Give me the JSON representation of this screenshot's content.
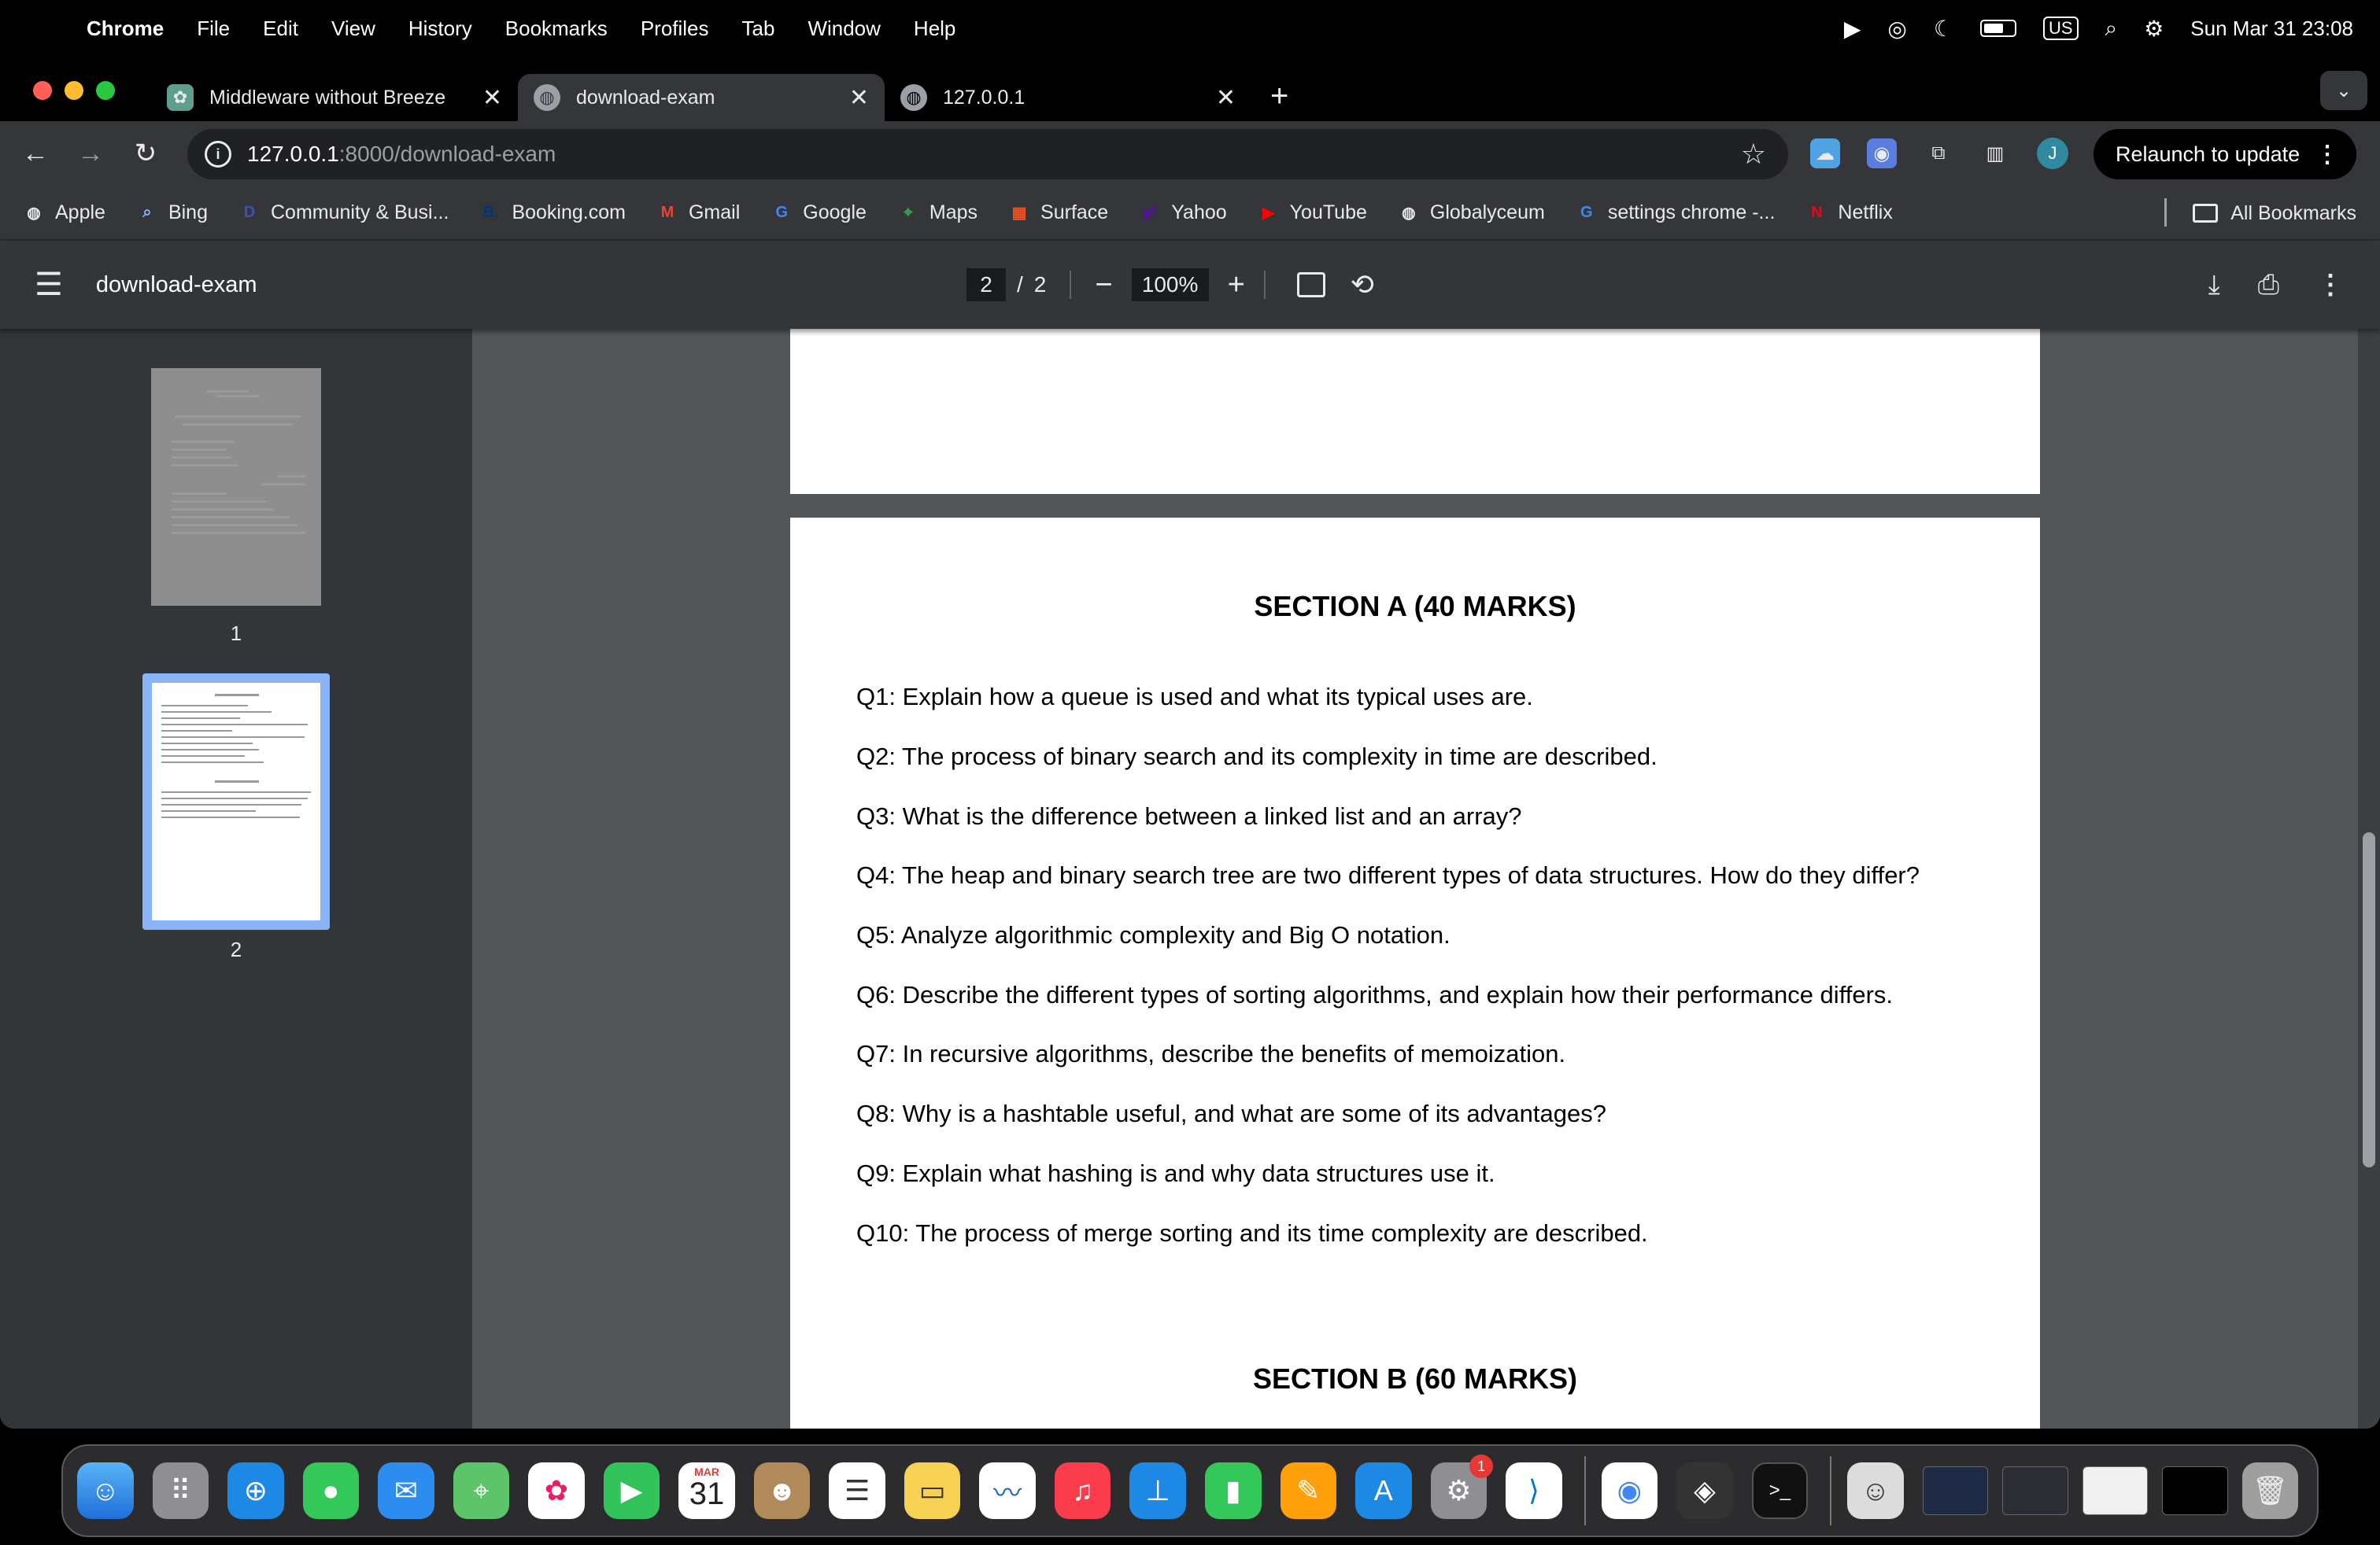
{
  "menubar": {
    "app": "Chrome",
    "items": [
      "File",
      "Edit",
      "View",
      "History",
      "Bookmarks",
      "Profiles",
      "Tab",
      "Window",
      "Help"
    ],
    "input_source": "US",
    "datetime": "Sun Mar 31  23:08"
  },
  "tabs": [
    {
      "title": "Middleware without Breeze",
      "active": false
    },
    {
      "title": "download-exam",
      "active": true
    },
    {
      "title": "127.0.0.1",
      "active": false
    }
  ],
  "omnibox": {
    "host": "127.0.0.1",
    "path": ":8000/download-exam"
  },
  "profile_initial": "J",
  "relaunch_label": "Relaunch to update",
  "bookmarks": [
    {
      "label": "Apple",
      "icon": "globe-icon",
      "color": "#e8eaed"
    },
    {
      "label": "Bing",
      "icon": "search-icon",
      "color": "#8ab4f8"
    },
    {
      "label": "Community & Busi...",
      "icon": "community-icon",
      "color": "#3f51b5"
    },
    {
      "label": "Booking.com",
      "icon": "booking-icon",
      "color": "#003580"
    },
    {
      "label": "Gmail",
      "icon": "gmail-icon",
      "color": "#ea4335"
    },
    {
      "label": "Google",
      "icon": "google-icon",
      "color": "#4285f4"
    },
    {
      "label": "Maps",
      "icon": "maps-icon",
      "color": "#34a853"
    },
    {
      "label": "Surface",
      "icon": "windows-icon",
      "color": "#f25022"
    },
    {
      "label": "Yahoo",
      "icon": "yahoo-icon",
      "color": "#6001d2"
    },
    {
      "label": "YouTube",
      "icon": "youtube-icon",
      "color": "#ff0000"
    },
    {
      "label": "Globalyceum",
      "icon": "globe-icon",
      "color": "#e8eaed"
    },
    {
      "label": "settings chrome -...",
      "icon": "google-icon",
      "color": "#4285f4"
    },
    {
      "label": "Netflix",
      "icon": "netflix-icon",
      "color": "#e50914"
    }
  ],
  "all_bookmarks_label": "All Bookmarks",
  "pdf": {
    "title": "download-exam",
    "current_page": "2",
    "separator": "/",
    "total_pages": "2",
    "zoom": "100%",
    "thumb_labels": [
      "1",
      "2"
    ],
    "section_a": "SECTION A (40 MARKS)",
    "questions": [
      "Q1: Explain how a queue is used and what its typical uses are.",
      "Q2: The process of binary search and its complexity in time are described.",
      "Q3: What is the difference between a linked list and an array?",
      "Q4: The heap and binary search tree are two different types of data structures. How do they differ?",
      "Q5: Analyze algorithmic complexity and Big O notation.",
      "Q6: Describe the different types of sorting algorithms, and explain how their performance differs.",
      "Q7: In recursive algorithms, describe the benefits of memoization.",
      "Q8: Why is a hashtable useful, and what are some of its advantages?",
      "Q9: Explain what hashing is and why data structures use it.",
      "Q10: The process of merge sorting and its time complexity are described."
    ],
    "section_b": "SECTION B (60 MARKS)"
  },
  "dock": {
    "calendar_month": "MAR",
    "calendar_day": "31",
    "settings_badge": "1"
  }
}
